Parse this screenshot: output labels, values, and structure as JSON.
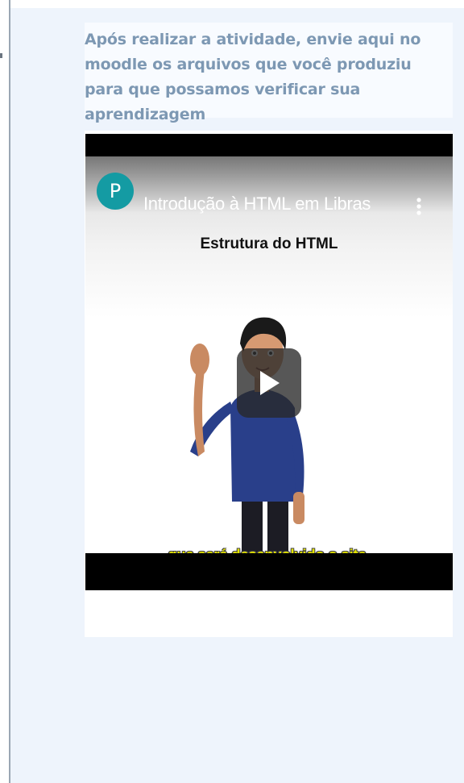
{
  "instruction": {
    "text": "Após realizar a atividade, envie aqui no moodle os arquivos que você produziu para que possamos verificar sua aprendizagem"
  },
  "video": {
    "channel_initial": "P",
    "title": "Introdução à HTML em Libras",
    "slide_heading": "Estrutura do HTML",
    "caption": "que será desenvolvido o site.",
    "icons": {
      "more": "kebab-menu-icon",
      "play": "play-icon"
    },
    "colors": {
      "avatar": "#149ba3",
      "caption": "#e6e600",
      "instruction_text": "#7d98b3",
      "panel": "#eef4fc"
    }
  }
}
